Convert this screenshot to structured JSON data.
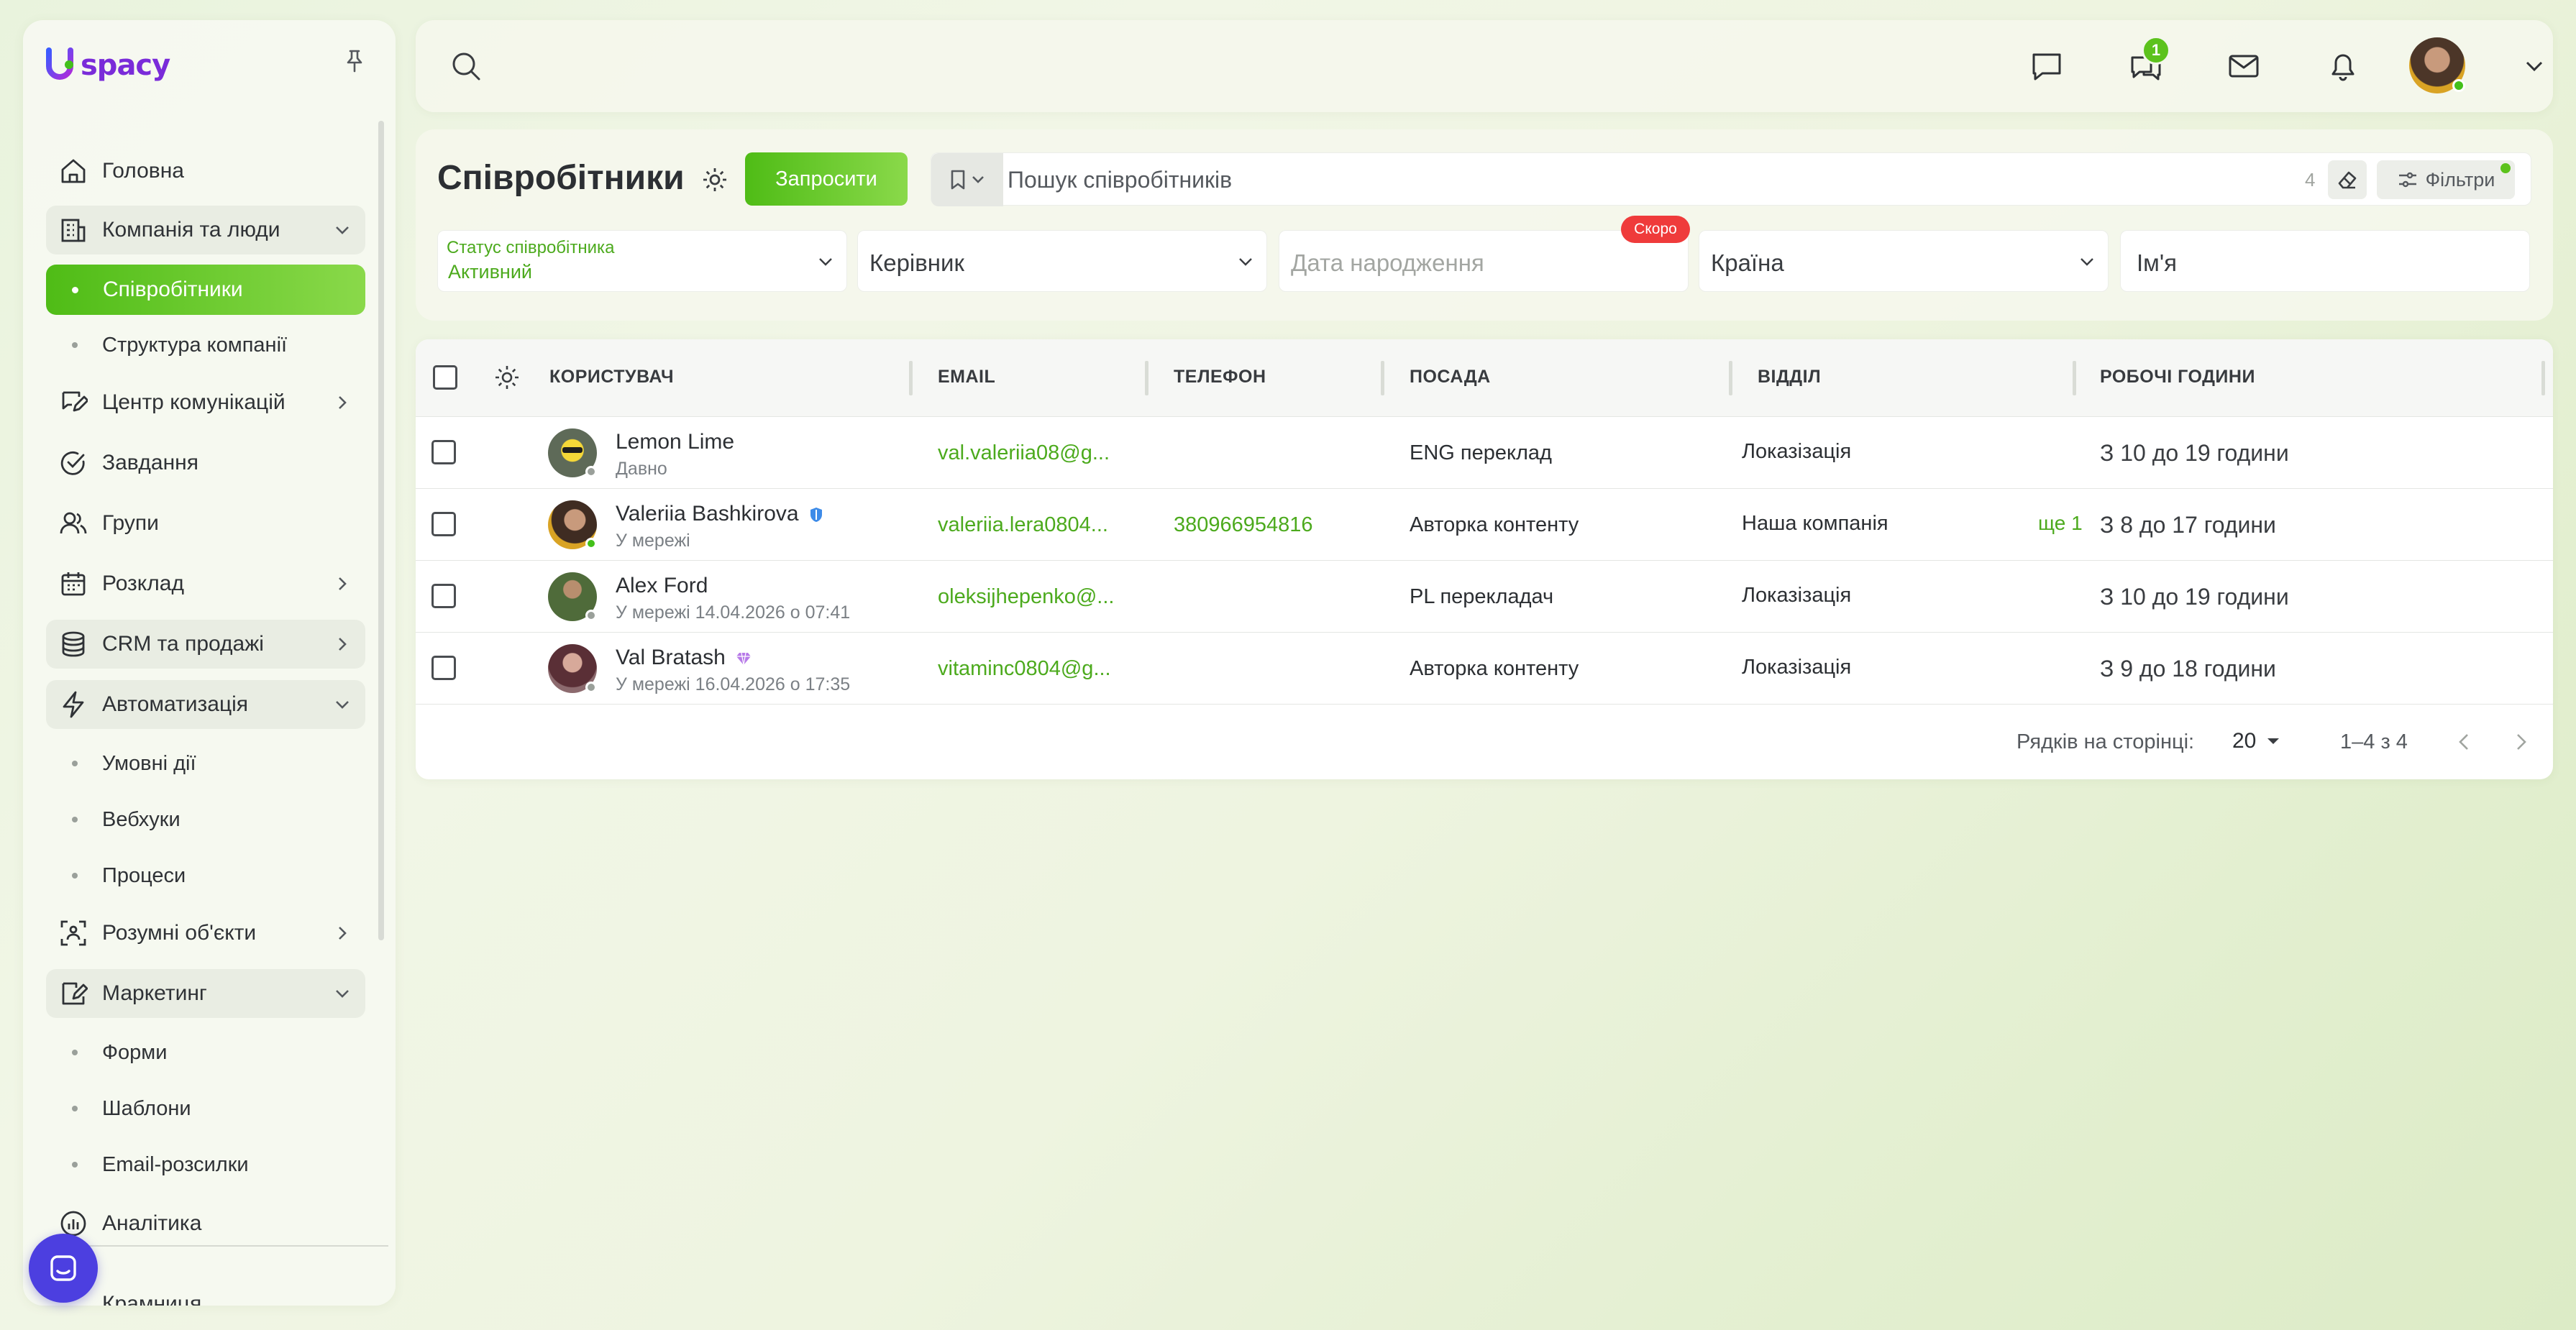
{
  "app": {
    "logo_text": "spacy"
  },
  "sidebar": {
    "items": [
      {
        "label": "Головна"
      },
      {
        "label": "Компанія та люди"
      },
      {
        "label": "Співробітники"
      },
      {
        "label": "Структура компанії"
      },
      {
        "label": "Центр комунікацій"
      },
      {
        "label": "Завдання"
      },
      {
        "label": "Групи"
      },
      {
        "label": "Розклад"
      },
      {
        "label": "CRM та продажі"
      },
      {
        "label": "Автоматизація"
      },
      {
        "label": "Умовні дії"
      },
      {
        "label": "Вебхуки"
      },
      {
        "label": "Процеси"
      },
      {
        "label": "Розумні об'єкти"
      },
      {
        "label": "Маркетинг"
      },
      {
        "label": "Форми"
      },
      {
        "label": "Шаблони"
      },
      {
        "label": "Email-розсилки"
      },
      {
        "label": "Аналітика"
      },
      {
        "label": "Крамниця"
      }
    ]
  },
  "topbar": {
    "chat_badge": "1"
  },
  "page": {
    "title": "Співробітники",
    "invite_label": "Запросити",
    "search_placeholder": "Пошук співробітників",
    "result_count": "4",
    "filters_label": "Фільтри",
    "soon_badge": "Скоро",
    "filters": {
      "status_label": "Статус співробітника",
      "status_value": "Активний",
      "manager": "Керівник",
      "birthday": "Дата народження",
      "country": "Країна",
      "name": "Ім'я"
    }
  },
  "table": {
    "headers": {
      "user": "КОРИСТУВАЧ",
      "email": "EMAIL",
      "phone": "ТЕЛЕФОН",
      "position": "ПОСАДА",
      "department": "ВІДДІЛ",
      "hours": "РОБОЧІ ГОДИНИ"
    },
    "rows": [
      {
        "name": "Lemon Lime",
        "status": "Давно",
        "email": "val.valeriia08@g...",
        "phone": "",
        "position": "ENG переклад",
        "department": "Локазізація",
        "more": "",
        "hours": "З 10 до 19 години"
      },
      {
        "name": "Valeriia Bashkirova",
        "status": "У мережі",
        "email": "valeriia.lera0804...",
        "phone": "380966954816",
        "position": "Авторка контенту",
        "department": "Наша компанія",
        "more": "ще 1",
        "hours": "З 8 до 17 години"
      },
      {
        "name": "Alex Ford",
        "status": "У мережі 14.04.2026 о 07:41",
        "email": "oleksijhepenko@...",
        "phone": "",
        "position": "PL перекладач",
        "department": "Локазізація",
        "more": "",
        "hours": "З 10 до 19 години"
      },
      {
        "name": "Val Bratash",
        "status": "У мережі 16.04.2026 о 17:35",
        "email": "vitaminc0804@g...",
        "phone": "",
        "position": "Авторка контенту",
        "department": "Локазізація",
        "more": "",
        "hours": "З 9 до 18 години"
      }
    ],
    "footer": {
      "rows_per_page_label": "Рядків на сторінці:",
      "rows_per_page": "20",
      "range": "1–4 з 4"
    }
  },
  "colors": {
    "accent": "#5cc21c",
    "link": "#4caa1d",
    "brand": "#7a2bd9",
    "soon": "#ef3b3b",
    "chat": "#4c3fe0"
  }
}
